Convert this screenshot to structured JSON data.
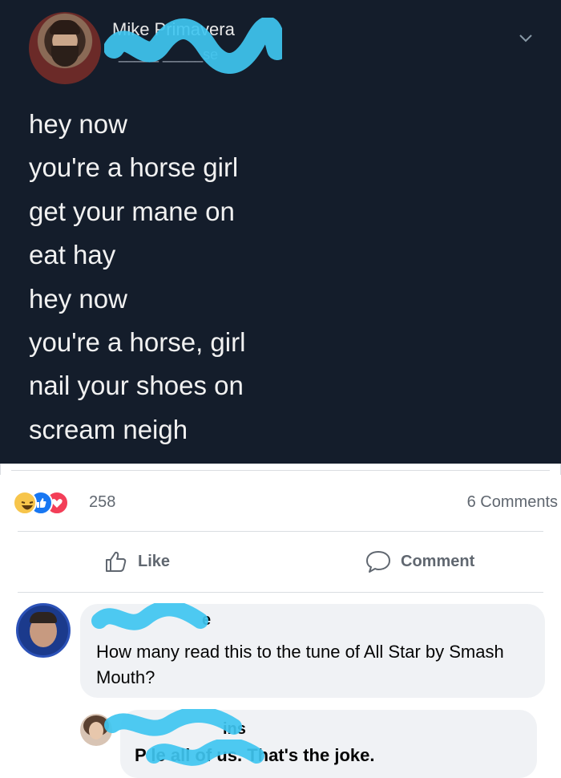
{
  "post": {
    "author_name": "Mike Primavera",
    "author_handle": "_____ _____se",
    "lines": [
      "hey now",
      "you're a horse girl",
      "get your mane on",
      "eat hay",
      "hey now",
      "you're a horse, girl",
      "nail your shoes on",
      "scream neigh"
    ]
  },
  "stats": {
    "reaction_count": "258",
    "comments_count": "6 Comments",
    "reactions": [
      "haha-icon",
      "like-icon",
      "love-icon"
    ]
  },
  "actions": {
    "like_label": "Like",
    "comment_label": "Comment"
  },
  "comments": [
    {
      "name": "e",
      "text": "How many read this to the tune of All Star by Smash Mouth?"
    },
    {
      "name": "ins",
      "text": "P          le all of us. That's the joke."
    }
  ],
  "colors": {
    "tweet_bg": "#141d2b",
    "redaction": "#3fc5f0",
    "like_blue": "#1877f2",
    "love_red": "#f33e58",
    "haha_yellow": "#f7c54b"
  }
}
